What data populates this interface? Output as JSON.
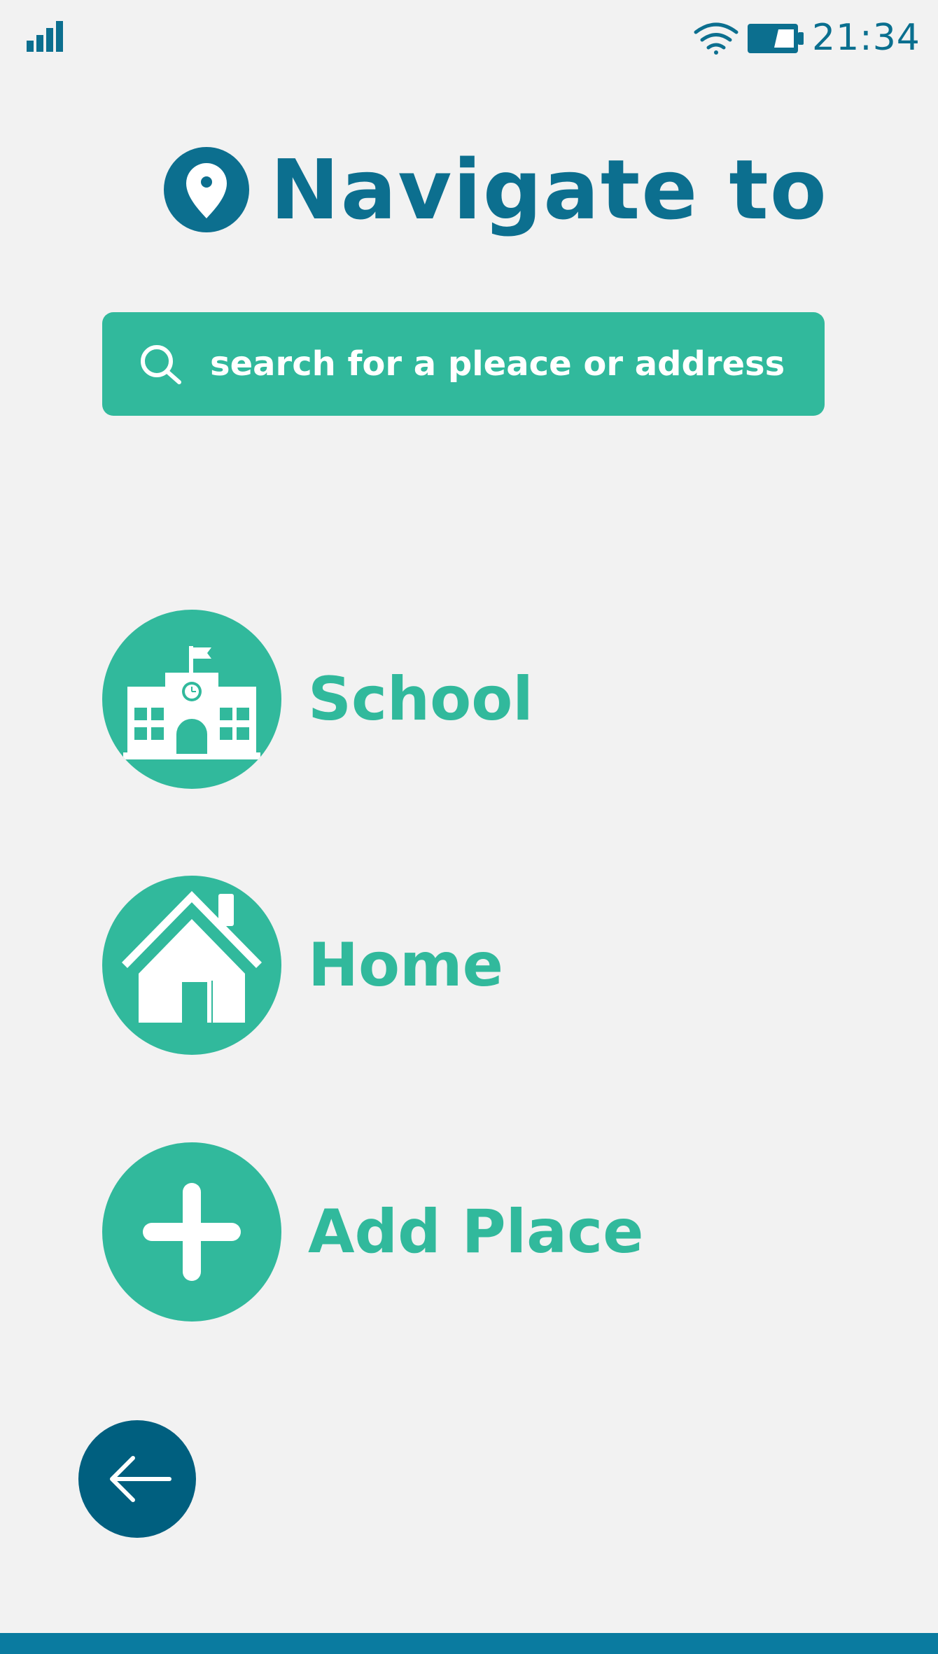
{
  "status_bar": {
    "time": "21:34",
    "icons": [
      "signal-icon",
      "wifi-icon",
      "battery-icon"
    ]
  },
  "header": {
    "title": "Navigate to",
    "icon": "map-pin-icon"
  },
  "search": {
    "placeholder": "search for a pleace or address",
    "icon": "search-icon"
  },
  "places": [
    {
      "label": "School",
      "icon": "school-icon"
    },
    {
      "label": "Home",
      "icon": "home-icon"
    },
    {
      "label": "Add Place",
      "icon": "plus-icon"
    }
  ],
  "navigation": {
    "back_icon": "back-arrow-icon"
  },
  "colors": {
    "background": "#f2f2f2",
    "primary_dark": "#0c6f8f",
    "accent": "#31b99c",
    "back_button": "#005f7f",
    "bottom_bar": "#0a7ba0"
  }
}
